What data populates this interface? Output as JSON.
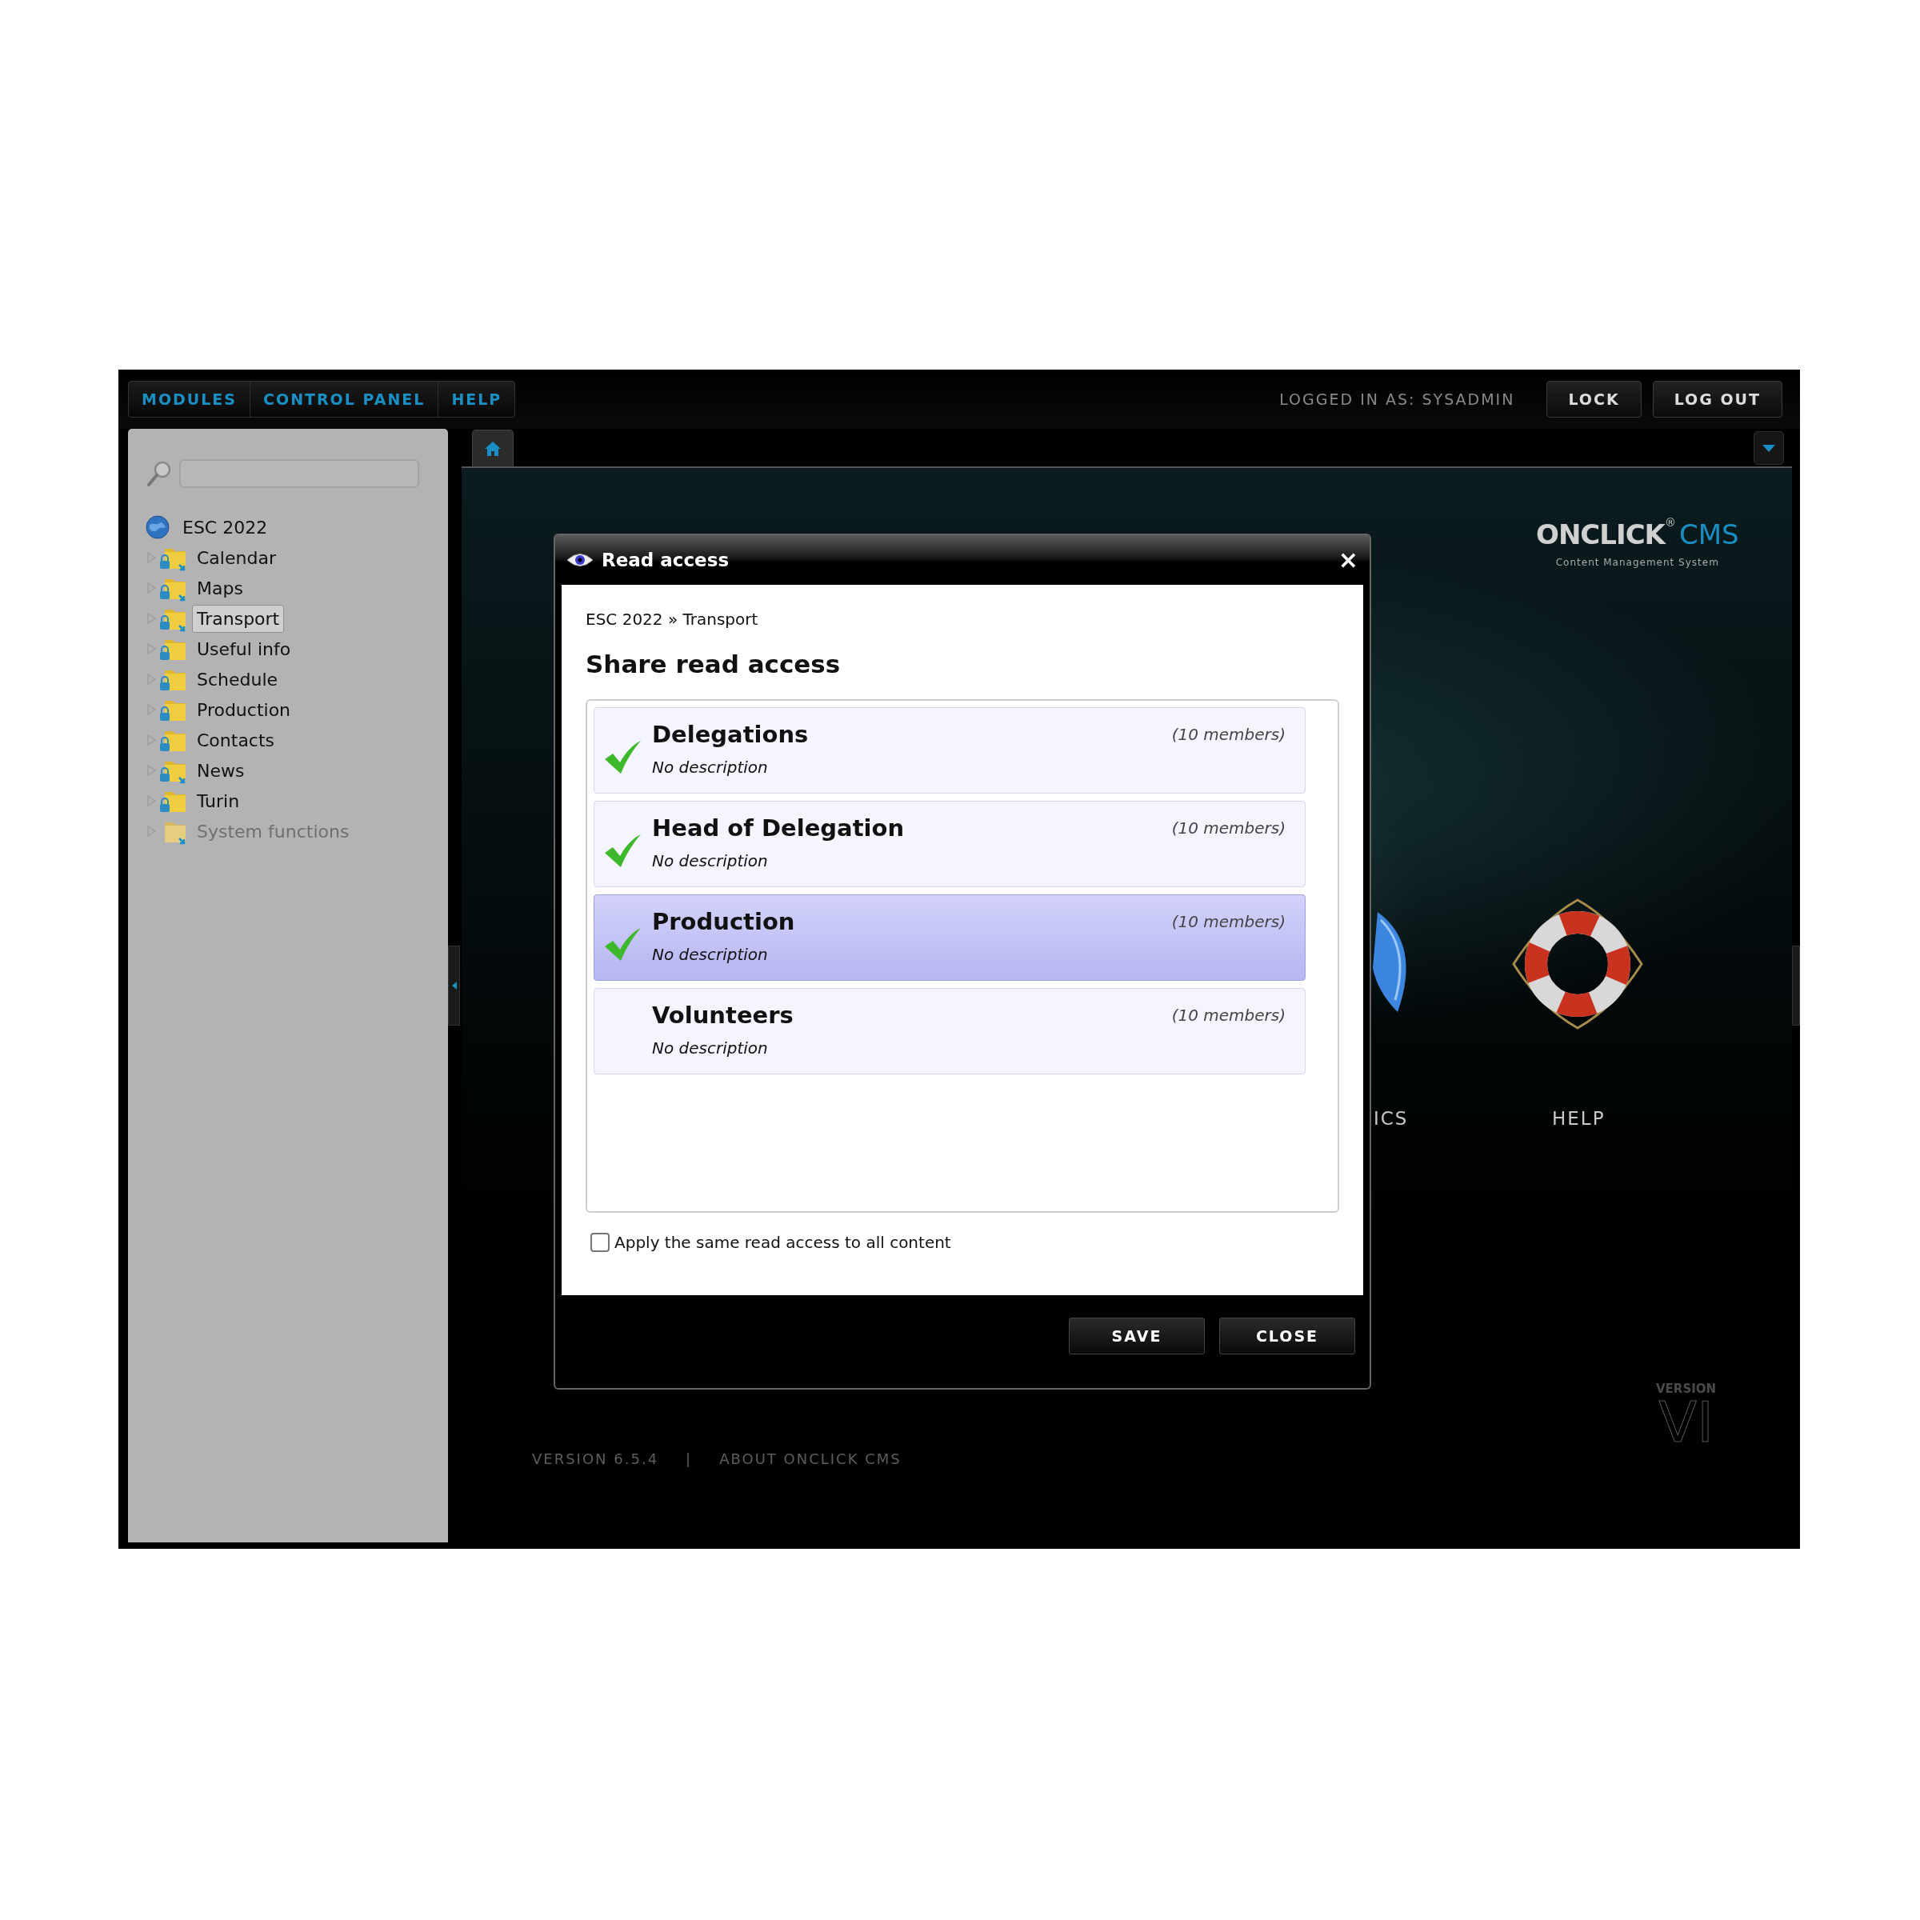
{
  "top_bar": {
    "menu": [
      "MODULES",
      "CONTROL PANEL",
      "HELP"
    ],
    "logged_in": "LOGGED IN AS: SYSADMIN",
    "buttons": [
      "LOCK",
      "LOG OUT"
    ]
  },
  "sidebar": {
    "tree": {
      "label": "ESC 2022",
      "children": [
        {
          "label": "Calendar",
          "locked": true,
          "shortcut": true,
          "selected": false,
          "disabled": false
        },
        {
          "label": "Maps",
          "locked": true,
          "shortcut": true,
          "selected": false,
          "disabled": false
        },
        {
          "label": "Transport",
          "locked": true,
          "shortcut": true,
          "selected": true,
          "disabled": false
        },
        {
          "label": "Useful info",
          "locked": true,
          "shortcut": false,
          "selected": false,
          "disabled": false
        },
        {
          "label": "Schedule",
          "locked": true,
          "shortcut": false,
          "selected": false,
          "disabled": false
        },
        {
          "label": "Production",
          "locked": true,
          "shortcut": false,
          "selected": false,
          "disabled": false
        },
        {
          "label": "Contacts",
          "locked": true,
          "shortcut": false,
          "selected": false,
          "disabled": false
        },
        {
          "label": "News",
          "locked": true,
          "shortcut": true,
          "selected": false,
          "disabled": false
        },
        {
          "label": "Turin",
          "locked": true,
          "shortcut": false,
          "selected": false,
          "disabled": false
        },
        {
          "label": "System functions",
          "locked": false,
          "shortcut": true,
          "selected": false,
          "disabled": true
        }
      ]
    }
  },
  "desktop": {
    "logo": {
      "brand": "ONCLICK",
      "mark": "®",
      "product": "CMS",
      "tagline": "Content Management System"
    },
    "items": [
      {
        "kind": "chart",
        "label": "ICS"
      },
      {
        "kind": "lifebuoy",
        "label": "HELP"
      }
    ],
    "footer": {
      "version": "VERSION 6.5.4",
      "separator": "|",
      "about": "ABOUT ONCLICK CMS"
    },
    "version_mark": {
      "caption": "VERSION",
      "numeral": "VI"
    }
  },
  "dialog": {
    "title": "Read access",
    "close": "×",
    "breadcrumb": "ESC 2022 » Transport",
    "heading": "Share read access",
    "groups": [
      {
        "name": "Delegations",
        "description": "No description",
        "members": "(10 members)",
        "checked": true,
        "selected": false
      },
      {
        "name": "Head of Delegation",
        "description": "No description",
        "members": "(10 members)",
        "checked": true,
        "selected": false
      },
      {
        "name": "Production",
        "description": "No description",
        "members": "(10 members)",
        "checked": true,
        "selected": true
      },
      {
        "name": "Volunteers",
        "description": "No description",
        "members": "(10 members)",
        "checked": false,
        "selected": false
      }
    ],
    "apply_all": {
      "label": "Apply the same read access to all content",
      "checked": false
    },
    "buttons": [
      "SAVE",
      "CLOSE"
    ]
  }
}
